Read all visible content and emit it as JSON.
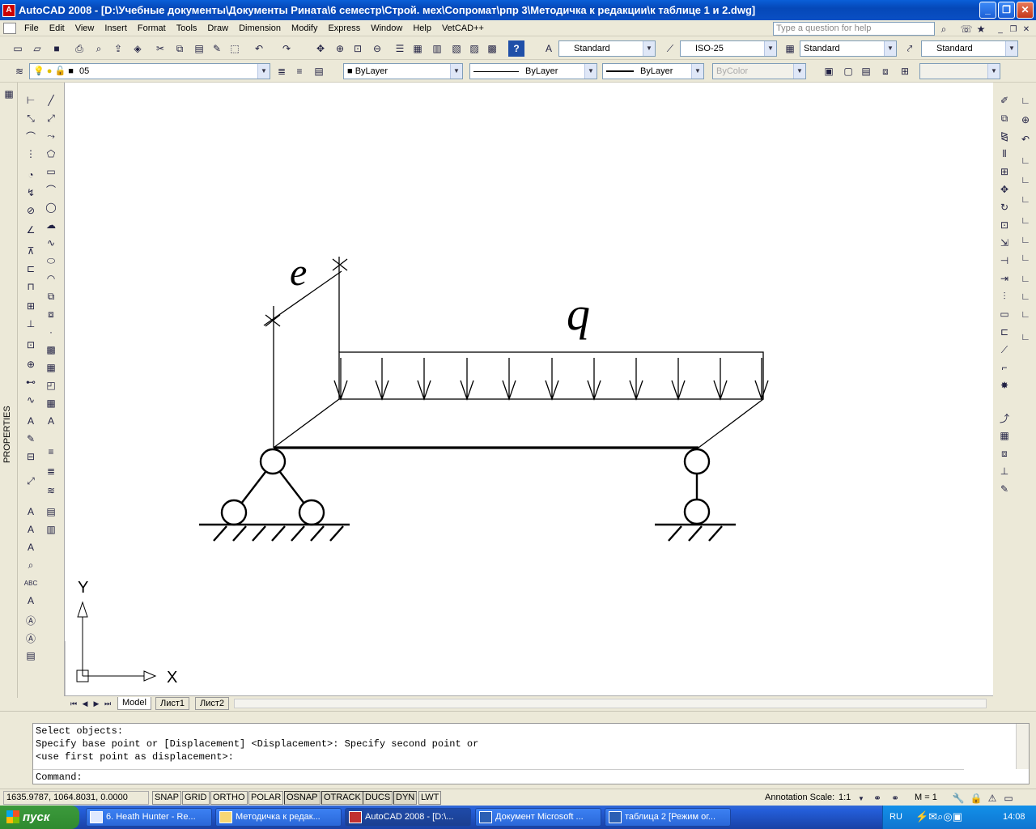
{
  "title": "AutoCAD 2008 - [D:\\Учебные документы\\Документы Рината\\6 семестр\\Строй. мех\\Сопромат\\рпр 3\\Методичка к редакции\\к таблице 1 и 2.dwg]",
  "menu": [
    "File",
    "Edit",
    "View",
    "Insert",
    "Format",
    "Tools",
    "Draw",
    "Dimension",
    "Modify",
    "Express",
    "Window",
    "Help",
    "VetCAD++"
  ],
  "help_placeholder": "Type a question for help",
  "styles": {
    "text_style": "Standard",
    "dim_style": "ISO-25",
    "table_style": "Standard",
    "mleader_style": "Standard"
  },
  "layer": "05",
  "properties": {
    "color": "ByLayer",
    "linetype": "ByLayer",
    "lineweight": "ByLayer",
    "plotstyle": "ByColor"
  },
  "side_palette": "PROPERTIES",
  "drawing": {
    "label_e": "e",
    "label_q": "q",
    "ucs_x": "X",
    "ucs_y": "Y"
  },
  "tabs": [
    "Model",
    "Лист1",
    "Лист2"
  ],
  "command_lines": [
    "Select objects:",
    "Specify base point or [Displacement] <Displacement>: Specify second point or",
    "<use first point as displacement>:"
  ],
  "command_prompt": "Command:",
  "status": {
    "coords": "1635.9787, 1064.8031, 0.0000",
    "toggles": [
      "SNAP",
      "GRID",
      "ORTHO",
      "POLAR",
      "OSNAP",
      "OTRACK",
      "DUCS",
      "DYN",
      "LWT"
    ],
    "toggles_on": [
      "OSNAP",
      "OTRACK",
      "DUCS",
      "DYN"
    ],
    "annotation_scale_label": "Annotation Scale:",
    "annotation_scale": "1:1",
    "m_value": "M = 1"
  },
  "taskbar": {
    "start": "пуск",
    "tasks": [
      {
        "label": "6. Heath Hunter - Re...",
        "active": false
      },
      {
        "label": "Методичка к редак...",
        "active": false
      },
      {
        "label": "AutoCAD 2008 - [D:\\...",
        "active": true
      },
      {
        "label": "Документ Microsoft ...",
        "active": false
      },
      {
        "label": "таблица 2 [Режим ог...",
        "active": false
      }
    ],
    "lang": "RU",
    "clock": "14:08"
  }
}
